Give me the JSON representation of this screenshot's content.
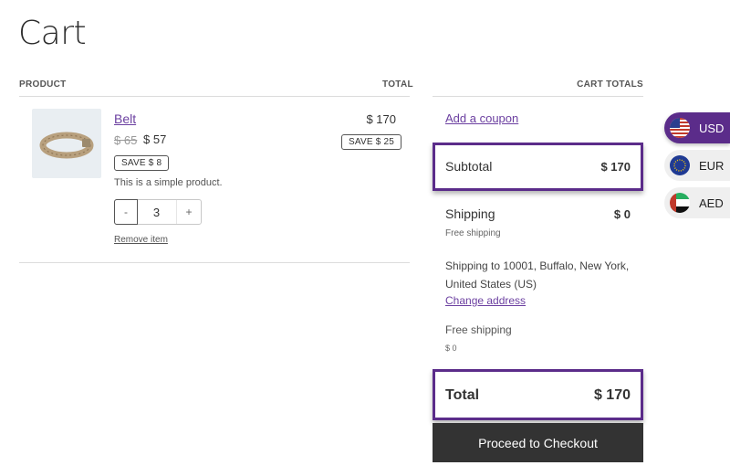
{
  "page": {
    "title": "Cart"
  },
  "table": {
    "col_product": "PRODUCT",
    "col_total": "TOTAL"
  },
  "item": {
    "name": "Belt",
    "old_price": "$ 65",
    "price": "$ 57",
    "save": "SAVE $ 8",
    "description": "This is a simple product.",
    "qty_minus": "-",
    "quantity": "3",
    "qty_plus": "+",
    "remove": "Remove item",
    "total": "$ 170",
    "total_save": "SAVE $ 25"
  },
  "totals": {
    "heading": "CART TOTALS",
    "coupon": "Add a coupon",
    "subtotal_label": "Subtotal",
    "subtotal_value": "$ 170",
    "shipping_label": "Shipping",
    "shipping_value": "$ 0",
    "shipping_method": "Free shipping",
    "shipping_to": "Shipping to 10001, Buffalo, New York, United States (US)",
    "change_address": "Change address",
    "free_shipping_label": "Free shipping",
    "free_shipping_value": "$ 0",
    "total_label": "Total",
    "total_value": "$ 170",
    "checkout": "Proceed to Checkout"
  },
  "currencies": [
    {
      "code": "USD",
      "icon": "us-flag-icon",
      "active": true
    },
    {
      "code": "EUR",
      "icon": "eu-flag-icon",
      "active": false
    },
    {
      "code": "AED",
      "icon": "uae-flag-icon",
      "active": false
    }
  ],
  "colors": {
    "accent": "#5b2c8a",
    "link": "#6b3fa0",
    "button": "#333333"
  }
}
